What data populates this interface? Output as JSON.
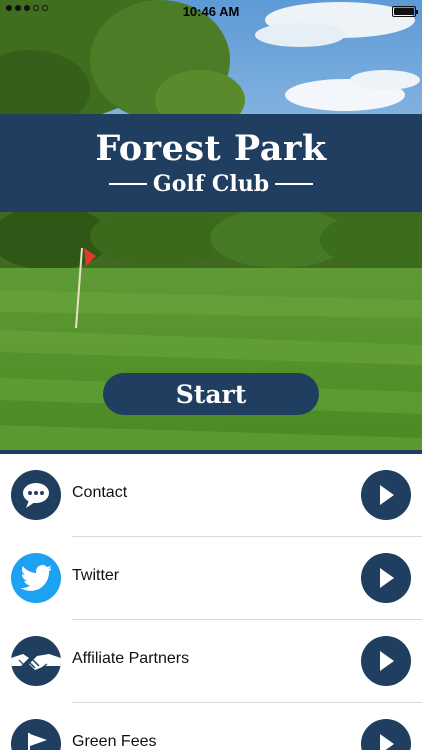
{
  "status_bar": {
    "time": "10:46 AM"
  },
  "hero": {
    "title": "Forest Park",
    "subtitle": "Golf Club",
    "start_label": "Start"
  },
  "menu": {
    "items": [
      {
        "label": "Contact",
        "icon": "speech-bubble-icon"
      },
      {
        "label": "Twitter",
        "icon": "twitter-bird-icon"
      },
      {
        "label": "Affiliate Partners",
        "icon": "handshake-icon"
      },
      {
        "label": "Green Fees",
        "icon": "golf-flag-icon"
      }
    ]
  },
  "colors": {
    "brand_navy": "#1f3e60",
    "twitter_blue": "#1da1f2",
    "separator": "#d9d9d9"
  }
}
